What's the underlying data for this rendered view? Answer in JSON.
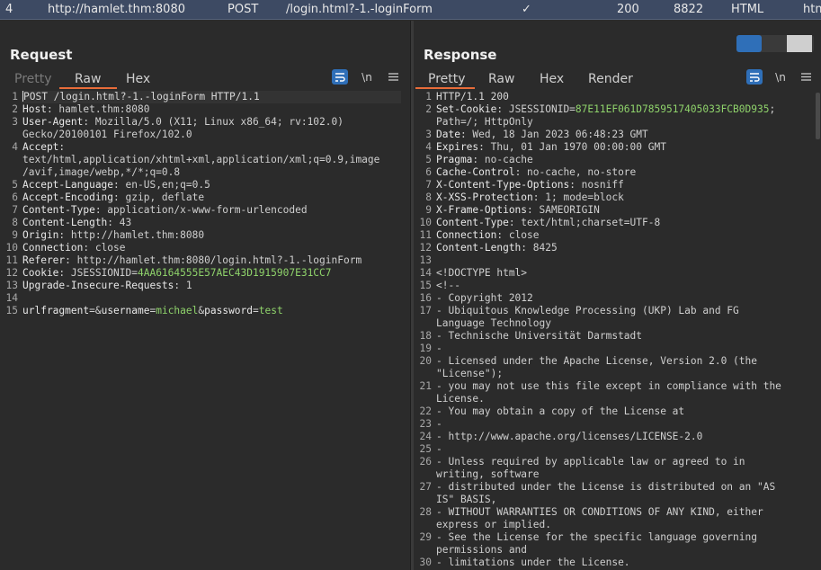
{
  "history_row": {
    "number": "4",
    "host": "http://hamlet.thm:8080",
    "method": "POST",
    "url": "/login.html?-1.-loginForm",
    "params_check": "✓",
    "status": "200",
    "length": "8822",
    "mime": "HTML",
    "extension": "htm"
  },
  "request": {
    "title": "Request",
    "tabs": [
      "Pretty",
      "Raw",
      "Hex"
    ],
    "active_tab": "Raw",
    "newline_label": "\\n",
    "lines": [
      {
        "n": "1",
        "parts": [
          [
            "plain",
            "POST /login.html?-1.-loginForm HTTP/1.1"
          ]
        ]
      },
      {
        "n": "2",
        "parts": [
          [
            "hdr",
            "Host"
          ],
          [
            "val",
            ": hamlet.thm:8080"
          ]
        ]
      },
      {
        "n": "3",
        "parts": [
          [
            "hdr",
            "User-Agent"
          ],
          [
            "val",
            ": Mozilla/5.0 (X11; Linux x86_64; rv:102.0)"
          ]
        ]
      },
      {
        "n": "",
        "parts": [
          [
            "val",
            "Gecko/20100101 Firefox/102.0"
          ]
        ]
      },
      {
        "n": "4",
        "parts": [
          [
            "hdr",
            "Accept"
          ],
          [
            "val",
            ":"
          ]
        ]
      },
      {
        "n": "",
        "parts": [
          [
            "val",
            "text/html,application/xhtml+xml,application/xml;q=0.9,image"
          ]
        ]
      },
      {
        "n": "",
        "parts": [
          [
            "val",
            "/avif,image/webp,*/*;q=0.8"
          ]
        ]
      },
      {
        "n": "5",
        "parts": [
          [
            "hdr",
            "Accept-Language"
          ],
          [
            "val",
            ": en-US,en;q=0.5"
          ]
        ]
      },
      {
        "n": "6",
        "parts": [
          [
            "hdr",
            "Accept-Encoding"
          ],
          [
            "val",
            ": gzip, deflate"
          ]
        ]
      },
      {
        "n": "7",
        "parts": [
          [
            "hdr",
            "Content-Type"
          ],
          [
            "val",
            ": application/x-www-form-urlencoded"
          ]
        ]
      },
      {
        "n": "8",
        "parts": [
          [
            "hdr",
            "Content-Length"
          ],
          [
            "val",
            ": 43"
          ]
        ]
      },
      {
        "n": "9",
        "parts": [
          [
            "hdr",
            "Origin"
          ],
          [
            "val",
            ": http://hamlet.thm:8080"
          ]
        ]
      },
      {
        "n": "10",
        "parts": [
          [
            "hdr",
            "Connection"
          ],
          [
            "val",
            ": close"
          ]
        ]
      },
      {
        "n": "11",
        "parts": [
          [
            "hdr",
            "Referer"
          ],
          [
            "val",
            ": http://hamlet.thm:8080/login.html?-1.-loginForm"
          ]
        ]
      },
      {
        "n": "12",
        "parts": [
          [
            "hdr",
            "Cookie"
          ],
          [
            "val",
            ": JSESSIONID="
          ],
          [
            "green",
            "4AA6164555E57AEC43D1915907E31CC7"
          ]
        ]
      },
      {
        "n": "13",
        "parts": [
          [
            "hdr",
            "Upgrade-Insecure-Requests"
          ],
          [
            "val",
            ": 1"
          ]
        ]
      },
      {
        "n": "14",
        "parts": []
      },
      {
        "n": "15",
        "parts": [
          [
            "hdr",
            "urlfragment"
          ],
          [
            "val",
            "=&"
          ],
          [
            "hdr",
            "username"
          ],
          [
            "val",
            "="
          ],
          [
            "green",
            "michael"
          ],
          [
            "val",
            "&"
          ],
          [
            "hdr",
            "password"
          ],
          [
            "val",
            "="
          ],
          [
            "green",
            "test"
          ]
        ]
      }
    ]
  },
  "response": {
    "title": "Response",
    "tabs": [
      "Pretty",
      "Raw",
      "Hex",
      "Render"
    ],
    "active_tab": "Pretty",
    "newline_label": "\\n",
    "lines": [
      {
        "n": "1",
        "parts": [
          [
            "plain",
            "HTTP/1.1 200"
          ]
        ]
      },
      {
        "n": "2",
        "parts": [
          [
            "hdr",
            "Set-Cookie"
          ],
          [
            "val",
            ": JSESSIONID="
          ],
          [
            "green",
            "87E11EF061D7859517405033FCB0D935"
          ],
          [
            "val",
            ";"
          ]
        ]
      },
      {
        "n": "",
        "parts": [
          [
            "val",
            "Path=/; HttpOnly"
          ]
        ]
      },
      {
        "n": "3",
        "parts": [
          [
            "hdr",
            "Date"
          ],
          [
            "val",
            ": Wed, 18 Jan 2023 06:48:23 GMT"
          ]
        ]
      },
      {
        "n": "4",
        "parts": [
          [
            "hdr",
            "Expires"
          ],
          [
            "val",
            ": Thu, 01 Jan 1970 00:00:00 GMT"
          ]
        ]
      },
      {
        "n": "5",
        "parts": [
          [
            "hdr",
            "Pragma"
          ],
          [
            "val",
            ": no-cache"
          ]
        ]
      },
      {
        "n": "6",
        "parts": [
          [
            "hdr",
            "Cache-Control"
          ],
          [
            "val",
            ": no-cache, no-store"
          ]
        ]
      },
      {
        "n": "7",
        "parts": [
          [
            "hdr",
            "X-Content-Type-Options"
          ],
          [
            "val",
            ": nosniff"
          ]
        ]
      },
      {
        "n": "8",
        "parts": [
          [
            "hdr",
            "X-XSS-Protection"
          ],
          [
            "val",
            ": 1; mode=block"
          ]
        ]
      },
      {
        "n": "9",
        "parts": [
          [
            "hdr",
            "X-Frame-Options"
          ],
          [
            "val",
            ": SAMEORIGIN"
          ]
        ]
      },
      {
        "n": "10",
        "parts": [
          [
            "hdr",
            "Content-Type"
          ],
          [
            "val",
            ": text/html;charset=UTF-8"
          ]
        ]
      },
      {
        "n": "11",
        "parts": [
          [
            "hdr",
            "Connection"
          ],
          [
            "val",
            ": close"
          ]
        ]
      },
      {
        "n": "12",
        "parts": [
          [
            "hdr",
            "Content-Length"
          ],
          [
            "val",
            ": 8425"
          ]
        ]
      },
      {
        "n": "13",
        "parts": []
      },
      {
        "n": "14",
        "parts": [
          [
            "val",
            "<!DOCTYPE html>"
          ]
        ]
      },
      {
        "n": "15",
        "parts": [
          [
            "val",
            "<!--"
          ]
        ]
      },
      {
        "n": "16",
        "parts": [
          [
            "val",
            "- Copyright 2012"
          ]
        ]
      },
      {
        "n": "17",
        "parts": [
          [
            "val",
            "- Ubiquitous Knowledge Processing (UKP) Lab and FG"
          ]
        ]
      },
      {
        "n": "",
        "parts": [
          [
            "val",
            "Language Technology"
          ]
        ]
      },
      {
        "n": "18",
        "parts": [
          [
            "val",
            "- Technische Universität Darmstadt"
          ]
        ]
      },
      {
        "n": "19",
        "parts": [
          [
            "val",
            "-"
          ]
        ]
      },
      {
        "n": "20",
        "parts": [
          [
            "val",
            "- Licensed under the Apache License, Version 2.0 (the"
          ]
        ]
      },
      {
        "n": "",
        "parts": [
          [
            "val",
            "\"License\");"
          ]
        ]
      },
      {
        "n": "21",
        "parts": [
          [
            "val",
            "- you may not use this file except in compliance with the"
          ]
        ]
      },
      {
        "n": "",
        "parts": [
          [
            "val",
            "License."
          ]
        ]
      },
      {
        "n": "22",
        "parts": [
          [
            "val",
            "- You may obtain a copy of the License at"
          ]
        ]
      },
      {
        "n": "23",
        "parts": [
          [
            "val",
            "-"
          ]
        ]
      },
      {
        "n": "24",
        "parts": [
          [
            "val",
            "- http://www.apache.org/licenses/LICENSE-2.0"
          ]
        ]
      },
      {
        "n": "25",
        "parts": [
          [
            "val",
            "-"
          ]
        ]
      },
      {
        "n": "26",
        "parts": [
          [
            "val",
            "- Unless required by applicable law or agreed to in"
          ]
        ]
      },
      {
        "n": "",
        "parts": [
          [
            "val",
            "writing, software"
          ]
        ]
      },
      {
        "n": "27",
        "parts": [
          [
            "val",
            "- distributed under the License is distributed on an \"AS"
          ]
        ]
      },
      {
        "n": "",
        "parts": [
          [
            "val",
            "IS\" BASIS,"
          ]
        ]
      },
      {
        "n": "28",
        "parts": [
          [
            "val",
            "- WITHOUT WARRANTIES OR CONDITIONS OF ANY KIND, either"
          ]
        ]
      },
      {
        "n": "",
        "parts": [
          [
            "val",
            "express or implied."
          ]
        ]
      },
      {
        "n": "29",
        "parts": [
          [
            "val",
            "- See the License for the specific language governing"
          ]
        ]
      },
      {
        "n": "",
        "parts": [
          [
            "val",
            "permissions and"
          ]
        ]
      },
      {
        "n": "30",
        "parts": [
          [
            "val",
            "- limitations under the License."
          ]
        ]
      }
    ]
  },
  "icons": {
    "wrap": "wrap-lines-icon",
    "newline": "newline-icon",
    "menu": "hamburger-menu-icon",
    "layout_side": "layout-side-by-side-icon",
    "layout_stacked": "layout-stacked-icon",
    "layout_tabs": "layout-tabs-icon"
  },
  "colors": {
    "accent_tab": "#e86c3a",
    "button_blue": "#2f6fb8",
    "value_green": "#8fd36b",
    "selected_row": "#3d4a63"
  }
}
